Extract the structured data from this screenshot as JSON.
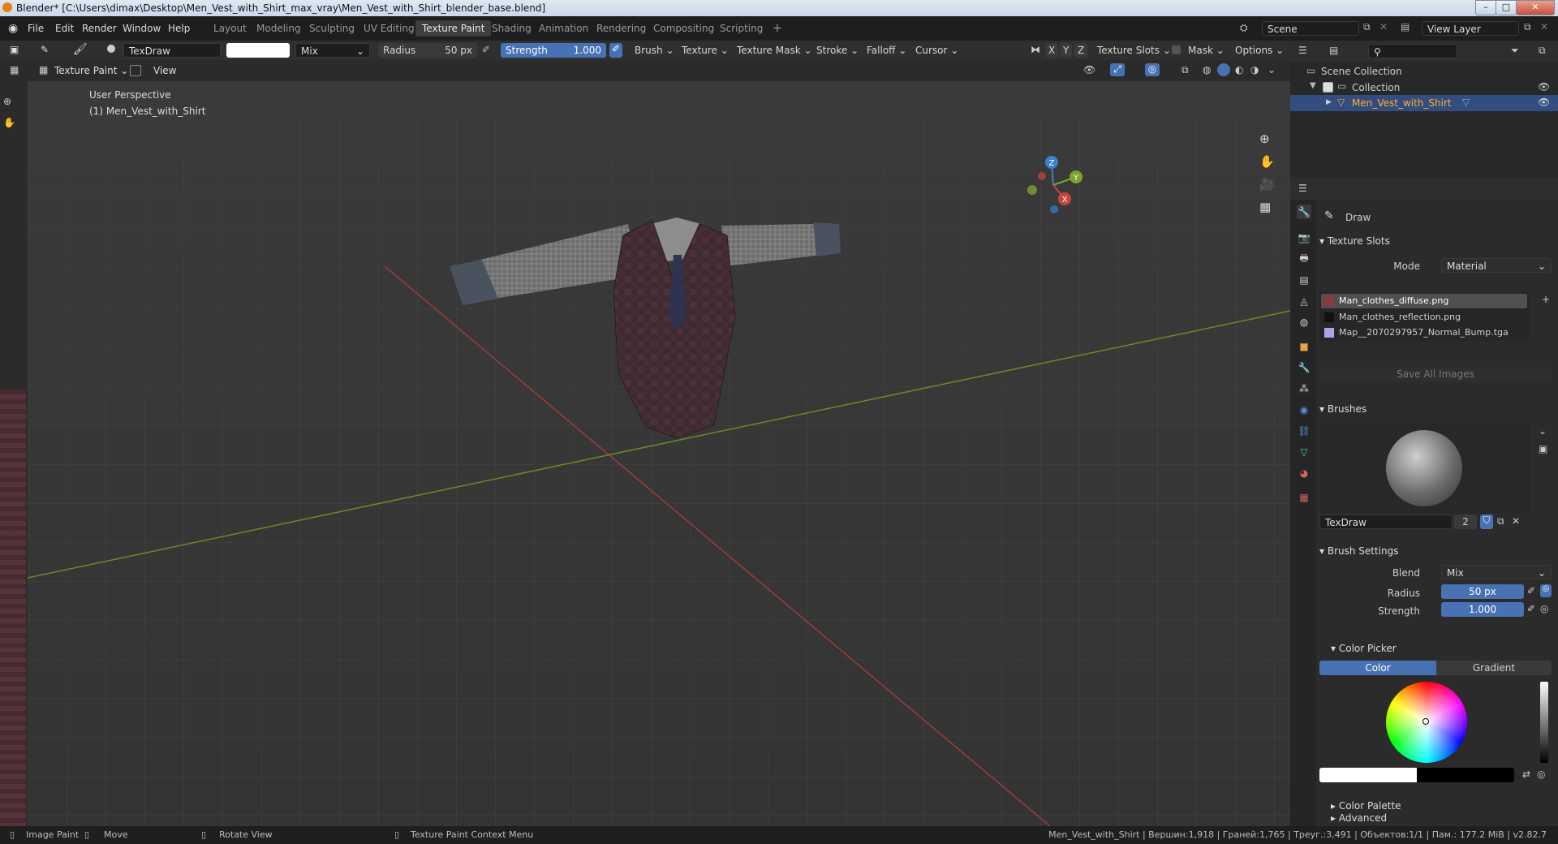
{
  "window": {
    "title": "Blender* [C:\\Users\\dimax\\Desktop\\Men_Vest_with_Shirt_max_vray\\Men_Vest_with_Shirt_blender_base.blend]",
    "minimize": "–",
    "maximize": "□",
    "close": "✕"
  },
  "menu": {
    "items": [
      "File",
      "Edit",
      "Render",
      "Window",
      "Help"
    ]
  },
  "workspaces": [
    "Layout",
    "Modeling",
    "Sculpting",
    "UV Editing",
    "Texture Paint",
    "Shading",
    "Animation",
    "Rendering",
    "Compositing",
    "Scripting"
  ],
  "workspace_add": "+",
  "scene": {
    "name": "Scene"
  },
  "view_layer": {
    "name": "View Layer"
  },
  "toolbar": {
    "brush_name": "TexDraw",
    "blend": "Mix",
    "radius_label": "Radius",
    "radius_value": "50 px",
    "strength_label": "Strength",
    "strength_value": "1.000",
    "menus": [
      "Brush",
      "Texture",
      "Texture Mask",
      "Stroke",
      "Falloff",
      "Cursor"
    ],
    "axes": [
      "X",
      "Y",
      "Z"
    ],
    "texture_slots": "Texture Slots",
    "mask": "Mask",
    "options": "Options"
  },
  "mode_header": {
    "mode": "Texture Paint",
    "view": "View"
  },
  "viewport": {
    "perspective": "User Perspective",
    "object": "(1) Men_Vest_with_Shirt",
    "gizmo": {
      "x": "X",
      "y": "Y",
      "z": "Z"
    }
  },
  "outliner": {
    "root": "Scene Collection",
    "collection": "Collection",
    "object": "Men_Vest_with_Shirt"
  },
  "properties": {
    "tool_name": "Draw",
    "texture_slots": {
      "title": "Texture Slots",
      "mode_label": "Mode",
      "mode_value": "Material",
      "slots": [
        "Man_clothes_diffuse.png",
        "Man_clothes_reflection.png",
        "Map__2070297957_Normal_Bump.tga"
      ],
      "save_button": "Save All Images"
    },
    "brushes": {
      "title": "Brushes",
      "brush_name": "TexDraw",
      "users": "2"
    },
    "brush_settings": {
      "title": "Brush Settings",
      "blend_label": "Blend",
      "blend_value": "Mix",
      "radius_label": "Radius",
      "radius_value": "50 px",
      "strength_label": "Strength",
      "strength_value": "1.000"
    },
    "color_picker": {
      "title": "Color Picker",
      "tab_color": "Color",
      "tab_gradient": "Gradient"
    },
    "color_palette": "Color Palette",
    "advanced": "Advanced"
  },
  "status_bar": {
    "left_hint": "Image Paint",
    "move_hint": "Move",
    "rotate_hint": "Rotate View",
    "context_hint": "Texture Paint Context Menu",
    "stats": "Men_Vest_with_Shirt | Вершин:1,918 | Граней:1,765 | Треуг.:3,491 | Объектов:1/1 | Пам.: 177.2 MiB | v2.82.7"
  },
  "colors": {
    "accent": "#4772b3",
    "x_axis": "#c8443c",
    "y_axis": "#7da22e",
    "z_axis": "#3b7fd0"
  }
}
